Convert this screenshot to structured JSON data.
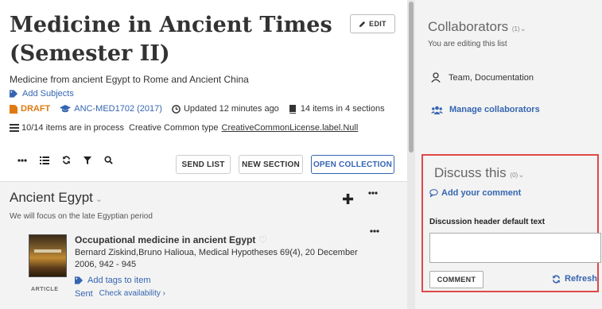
{
  "list": {
    "title": "Medicine in Ancient Times (Semester II)",
    "edit_label": "EDIT",
    "description": "Medicine from ancient Egypt to Rome and Ancient China",
    "add_subjects": "Add Subjects",
    "status": "DRAFT",
    "course": "ANC-MED1702 (2017)",
    "updated": "Updated 12 minutes ago",
    "items_count": "14 items in 4 sections",
    "process": "10/14 items are in process",
    "license_label": "Creative Common type",
    "license_value": "CreativeCommonLicense.label.Null"
  },
  "toolbar": {
    "send_list": "SEND LIST",
    "new_section": "NEW SECTION",
    "open_collection": "OPEN COLLECTION"
  },
  "section": {
    "title": "Ancient Egypt",
    "description": "We will focus on the late Egyptian period",
    "item": {
      "title": "Occupational medicine in ancient Egypt",
      "meta": "Bernard Ziskind,Bruno Halioua, Medical Hypotheses 69(4), 20 December 2006, 942 - 945",
      "type": "ARTICLE",
      "add_tags": "Add tags to item",
      "status": "Sent",
      "availability": "Check availability ›"
    }
  },
  "collaborators": {
    "title": "Collaborators",
    "count": "(1)",
    "editing": "You are editing this list",
    "member": "Team, Documentation",
    "manage": "Manage collaborators"
  },
  "discussion": {
    "title": "Discuss this",
    "count": "(0)",
    "add_comment": "Add your comment",
    "header": "Discussion header default text",
    "comment_button": "COMMENT",
    "refresh": "Refresh"
  },
  "colors": {
    "accent": "#3565b1",
    "draft": "#e07a10",
    "highlight": "#e04848"
  }
}
